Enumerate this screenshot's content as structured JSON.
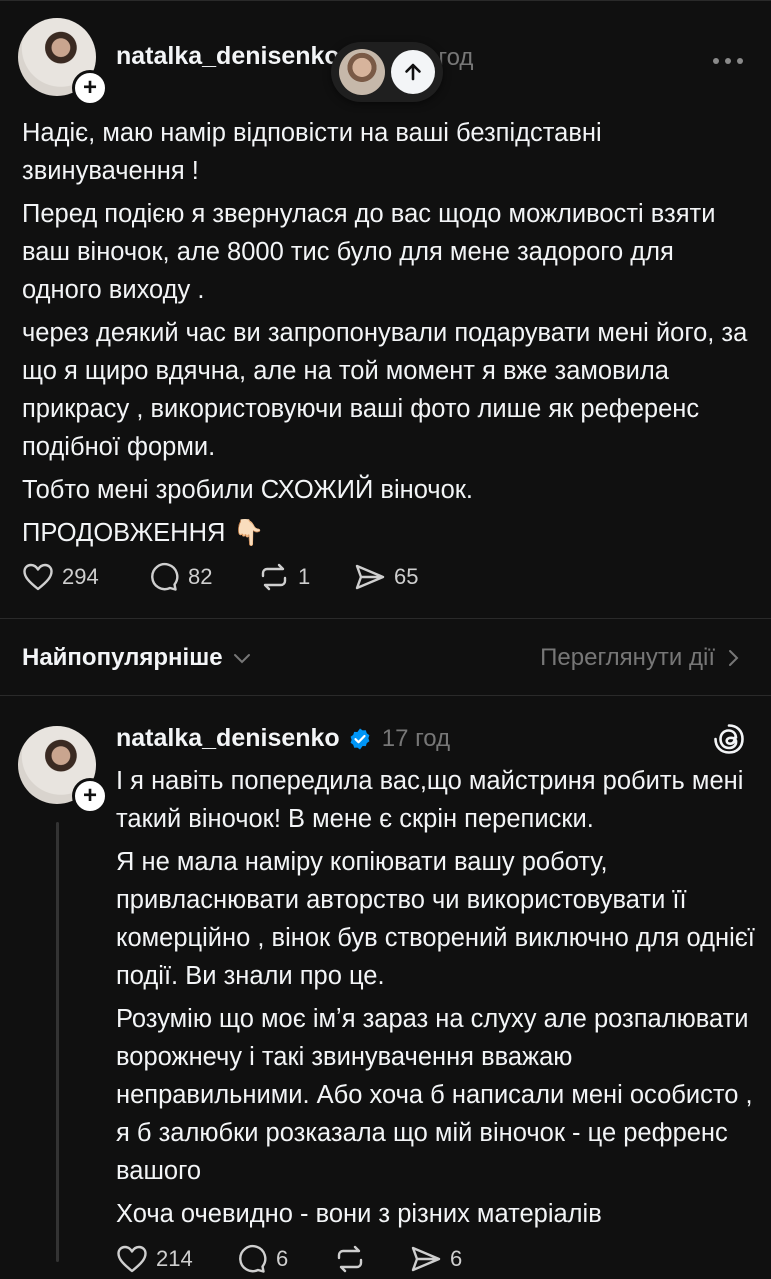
{
  "post": {
    "username": "natalka_denisenko",
    "time": "17 год",
    "more_icon": "more-icon",
    "paragraphs": [
      "Надіє, маю намір відповісти на ваші безпідставні звинувачення !",
      "Перед подією я звернулася до вас щодо можливості взяти ваш віночок, але 8000 тис було для мене задорого для одного виходу .",
      "через деякий час ви запропонували подарувати мені його, за що я щиро вдячна, але на той момент я вже замовила прикрасу , використовуючи ваші фото лише як референс подібної форми.",
      "Тобто мені зробили СХОЖИЙ віночок.",
      "ПРОДОВЖЕННЯ 👇🏻"
    ],
    "likes": "294",
    "comments": "82",
    "reposts": "1",
    "shares": "65"
  },
  "sort_bar": {
    "label": "Найпопулярніше",
    "view_activity": "Переглянути дії"
  },
  "reply": {
    "username": "natalka_denisenko",
    "time": "17 год",
    "paragraphs": [
      "І я навіть попередила вас,що майстриня робить мені такий віночок! В мене є скрін переписки.",
      "Я не мала наміру копіювати вашу роботу, привласнювати авторство чи використовувати її комерційно , вінок був створений виключно для однієї події. Ви знали про це.",
      "Розумію що моє імʼя зараз на слуху але розпалювати ворожнечу і такі звинувачення вважаю неправильними. Або хоча б написали мені особисто , я б залюбки розказала що мій віночок - це рефренс вашого",
      "Хоча очевидно - вони з різних матеріалів"
    ],
    "likes": "214",
    "comments": "6",
    "shares": "6"
  },
  "colors": {
    "background": "#101010",
    "text": "#f3f5f7",
    "muted": "#777777",
    "verified": "#0095f6"
  }
}
